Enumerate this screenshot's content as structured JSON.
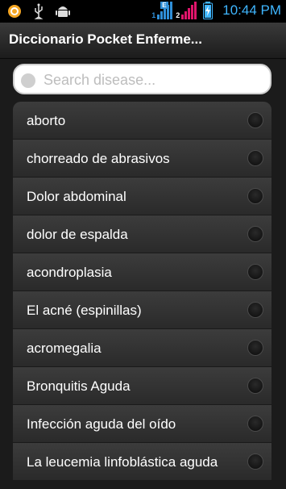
{
  "status_bar": {
    "time": "10:44 PM",
    "sim1_label": "1",
    "sim1_network": "E",
    "sim2_label": "2",
    "icons": [
      "sync-icon",
      "usb-icon",
      "android-icon",
      "battery-charging-icon"
    ]
  },
  "header": {
    "title": "Diccionario Pocket Enferme..."
  },
  "search": {
    "placeholder": "Search disease..."
  },
  "list": {
    "items": [
      {
        "label": "aborto"
      },
      {
        "label": "chorreado de abrasivos"
      },
      {
        "label": "Dolor abdominal"
      },
      {
        "label": "dolor de espalda"
      },
      {
        "label": "acondroplasia"
      },
      {
        "label": "El acné (espinillas)"
      },
      {
        "label": "acromegalia"
      },
      {
        "label": "Bronquitis Aguda"
      },
      {
        "label": "Infección aguda del oído"
      },
      {
        "label": "La leucemia linfoblástica aguda"
      }
    ]
  },
  "colors": {
    "clock": "#3fb6ff",
    "sim1": "#2f8fd8",
    "sim2": "#e0156b"
  }
}
